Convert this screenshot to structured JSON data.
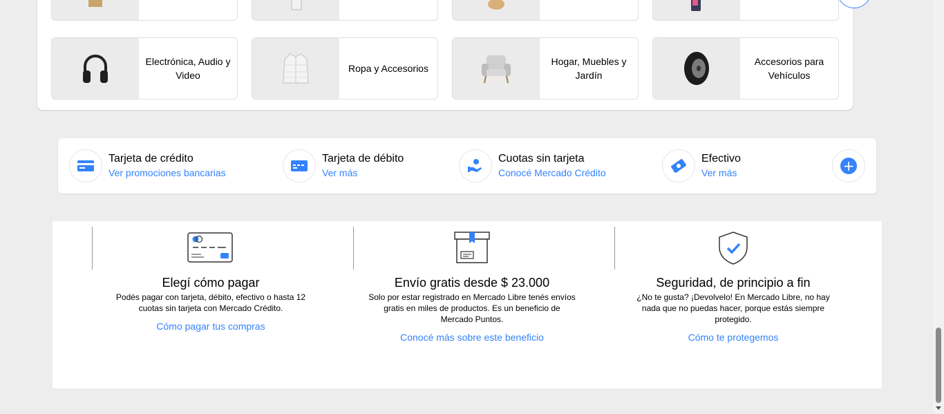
{
  "categories": {
    "top_row": [
      {
        "icon": "ring-box-icon"
      },
      {
        "icon": "tablet-icon"
      },
      {
        "icon": "teddy-bear-icon"
      },
      {
        "icon": "smartphone-icon"
      }
    ],
    "items": [
      {
        "label": "Electrónica, Audio y Video",
        "icon": "headphones-icon"
      },
      {
        "label": "Ropa y Accesorios",
        "icon": "jacket-icon"
      },
      {
        "label": "Hogar, Muebles y Jardín",
        "icon": "armchair-icon"
      },
      {
        "label": "Accesorios para Vehículos",
        "icon": "tire-icon"
      }
    ]
  },
  "payments": [
    {
      "title": "Tarjeta de crédito",
      "link": "Ver promociones bancarias",
      "icon": "credit-card-icon"
    },
    {
      "title": "Tarjeta de débito",
      "link": "Ver más",
      "icon": "debit-card-icon"
    },
    {
      "title": "Cuotas sin tarjeta",
      "link": "Conocé Mercado Crédito",
      "icon": "hand-coin-icon"
    },
    {
      "title": "Efectivo",
      "link": "Ver más",
      "icon": "cash-icon"
    }
  ],
  "benefits": [
    {
      "title": "Elegí cómo pagar",
      "text": "Podés pagar con tarjeta, débito, efectivo o hasta 12 cuotas sin tarjeta con Mercado Crédito.",
      "link": "Cómo pagar tus compras",
      "icon": "payment-card-icon"
    },
    {
      "title": "Envío gratis desde $ 23.000",
      "text": "Solo por estar registrado en Mercado Libre tenés envíos gratis en miles de productos. Es un beneficio de Mercado Puntos.",
      "link": "Conocé más sobre este beneficio",
      "icon": "shipping-box-icon"
    },
    {
      "title": "Seguridad, de principio a fin",
      "text": "¿No te gusta? ¡Devolvelo! En Mercado Libre, no hay nada que no puedas hacer, porque estás siempre protegido.",
      "link": "Cómo te protegemos",
      "icon": "shield-check-icon"
    }
  ],
  "colors": {
    "accent": "#3483fa",
    "background": "#ededed",
    "tile_image_bg": "#ebebeb"
  }
}
